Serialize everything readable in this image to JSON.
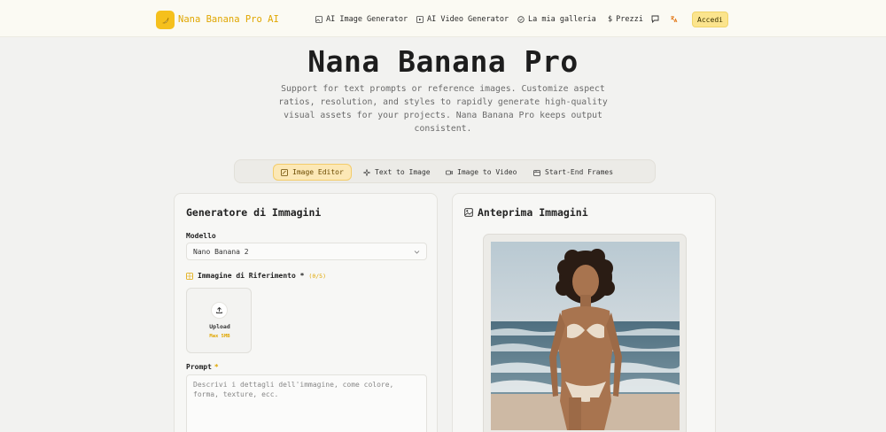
{
  "header": {
    "brand": "Nana Banana Pro AI",
    "nav": [
      {
        "label": "AI Image Generator",
        "icon": "image-icon"
      },
      {
        "label": "AI Video Generator",
        "icon": "video-icon"
      },
      {
        "label": "La mia galleria",
        "icon": "gallery-icon"
      },
      {
        "label": "Prezzi",
        "icon": "dollar-icon"
      }
    ],
    "login_label": "Accedi"
  },
  "hero": {
    "title": "Nana Banana Pro",
    "subtitle": "Support for text prompts or reference images. Customize aspect ratios, resolution, and styles to rapidly generate high-quality visual assets for your projects. Nana Banana Pro keeps output consistent."
  },
  "tabs": [
    {
      "label": "Image Editor",
      "active": true
    },
    {
      "label": "Text to Image",
      "active": false
    },
    {
      "label": "Image to Video",
      "active": false
    },
    {
      "label": "Start-End Frames",
      "active": false
    }
  ],
  "generator": {
    "title": "Generatore di Immagini",
    "model_label": "Modello",
    "model_value": "Nano Banana 2",
    "reference_label": "Immagine di Riferimento *",
    "reference_count": "(0/5)",
    "upload_label": "Upload",
    "upload_max": "Max 5MB",
    "prompt_label": "Prompt",
    "prompt_required": "*",
    "prompt_placeholder": "Descrivi i dettagli dell'immagine, come colore, forma, texture, ecc."
  },
  "preview": {
    "title": "Anteprima Immagini"
  },
  "colors": {
    "accent": "#f5c01d",
    "accent_text": "#e0a600",
    "active_tab_bg": "#fce8b6"
  }
}
